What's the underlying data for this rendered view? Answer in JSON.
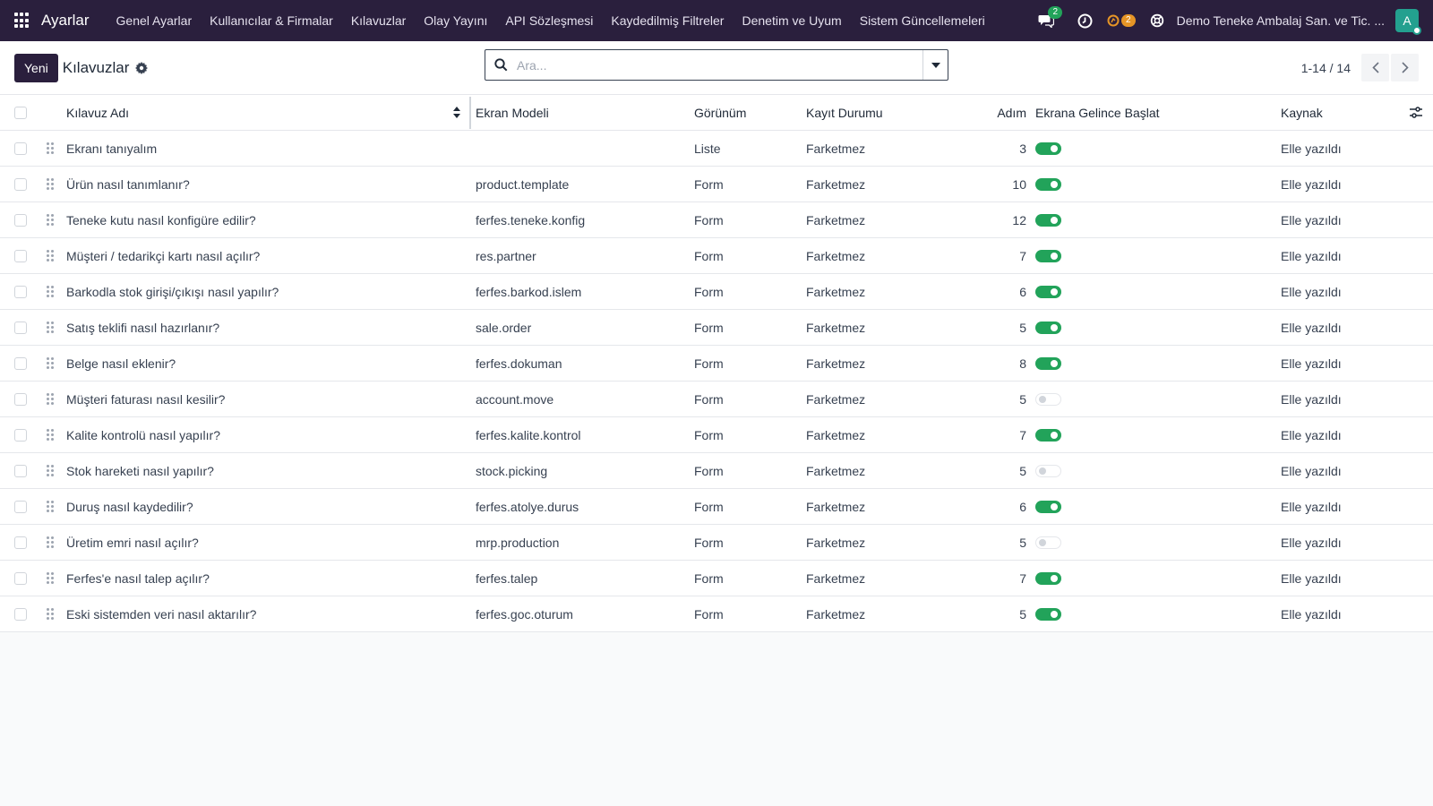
{
  "navbar": {
    "brand": "Ayarlar",
    "menu": [
      "Genel Ayarlar",
      "Kullanıcılar & Firmalar",
      "Kılavuzlar",
      "Olay Yayını",
      "API Sözleşmesi",
      "Kaydedilmiş Filtreler",
      "Denetim ve Uyum",
      "Sistem Güncellemeleri"
    ],
    "messages_count": "2",
    "activities_count": "2",
    "company": "Demo Teneke Ambalaj San. ve Tic. ...",
    "avatar_letter": "A"
  },
  "control": {
    "new_label": "Yeni",
    "title": "Kılavuzlar",
    "search_placeholder": "Ara...",
    "pager": "1-14 / 14"
  },
  "table": {
    "headers": {
      "name": "Kılavuz Adı",
      "model": "Ekran Modeli",
      "view": "Görünüm",
      "state": "Kayıt Durumu",
      "steps": "Adım",
      "auto": "Ekrana Gelince Başlat",
      "source": "Kaynak"
    },
    "rows": [
      {
        "name": "Ekranı tanıyalım",
        "model": "",
        "view": "Liste",
        "state": "Farketmez",
        "steps": "3",
        "auto": true,
        "source": "Elle yazıldı"
      },
      {
        "name": "Ürün nasıl tanımlanır?",
        "model": "product.template",
        "view": "Form",
        "state": "Farketmez",
        "steps": "10",
        "auto": true,
        "source": "Elle yazıldı"
      },
      {
        "name": "Teneke kutu nasıl konfigüre edilir?",
        "model": "ferfes.teneke.konfig",
        "view": "Form",
        "state": "Farketmez",
        "steps": "12",
        "auto": true,
        "source": "Elle yazıldı"
      },
      {
        "name": "Müşteri / tedarikçi kartı nasıl açılır?",
        "model": "res.partner",
        "view": "Form",
        "state": "Farketmez",
        "steps": "7",
        "auto": true,
        "source": "Elle yazıldı"
      },
      {
        "name": "Barkodla stok girişi/çıkışı nasıl yapılır?",
        "model": "ferfes.barkod.islem",
        "view": "Form",
        "state": "Farketmez",
        "steps": "6",
        "auto": true,
        "source": "Elle yazıldı"
      },
      {
        "name": "Satış teklifi nasıl hazırlanır?",
        "model": "sale.order",
        "view": "Form",
        "state": "Farketmez",
        "steps": "5",
        "auto": true,
        "source": "Elle yazıldı"
      },
      {
        "name": "Belge nasıl eklenir?",
        "model": "ferfes.dokuman",
        "view": "Form",
        "state": "Farketmez",
        "steps": "8",
        "auto": true,
        "source": "Elle yazıldı"
      },
      {
        "name": "Müşteri faturası nasıl kesilir?",
        "model": "account.move",
        "view": "Form",
        "state": "Farketmez",
        "steps": "5",
        "auto": false,
        "source": "Elle yazıldı"
      },
      {
        "name": "Kalite kontrolü nasıl yapılır?",
        "model": "ferfes.kalite.kontrol",
        "view": "Form",
        "state": "Farketmez",
        "steps": "7",
        "auto": true,
        "source": "Elle yazıldı"
      },
      {
        "name": "Stok hareketi nasıl yapılır?",
        "model": "stock.picking",
        "view": "Form",
        "state": "Farketmez",
        "steps": "5",
        "auto": false,
        "source": "Elle yazıldı"
      },
      {
        "name": "Duruş nasıl kaydedilir?",
        "model": "ferfes.atolye.durus",
        "view": "Form",
        "state": "Farketmez",
        "steps": "6",
        "auto": true,
        "source": "Elle yazıldı"
      },
      {
        "name": "Üretim emri nasıl açılır?",
        "model": "mrp.production",
        "view": "Form",
        "state": "Farketmez",
        "steps": "5",
        "auto": false,
        "source": "Elle yazıldı"
      },
      {
        "name": "Ferfes'e nasıl talep açılır?",
        "model": "ferfes.talep",
        "view": "Form",
        "state": "Farketmez",
        "steps": "7",
        "auto": true,
        "source": "Elle yazıldı"
      },
      {
        "name": "Eski sistemden veri nasıl aktarılır?",
        "model": "ferfes.goc.oturum",
        "view": "Form",
        "state": "Farketmez",
        "steps": "5",
        "auto": true,
        "source": "Elle yazıldı"
      }
    ]
  },
  "colors": {
    "navbar_bg": "#2a1f3d",
    "toggle_on": "#22a35a",
    "badge_green": "#22a35a",
    "badge_orange": "#e69526",
    "avatar_bg": "#23a08f"
  },
  "icons": [
    "apps-grid-icon",
    "chat-icon",
    "clock-icon",
    "activity-icon",
    "support-icon",
    "gear-icon",
    "search-icon",
    "caret-down-icon",
    "chevron-left-icon",
    "chevron-right-icon",
    "sort-icon",
    "optional-columns-icon",
    "drag-handle-icon"
  ]
}
